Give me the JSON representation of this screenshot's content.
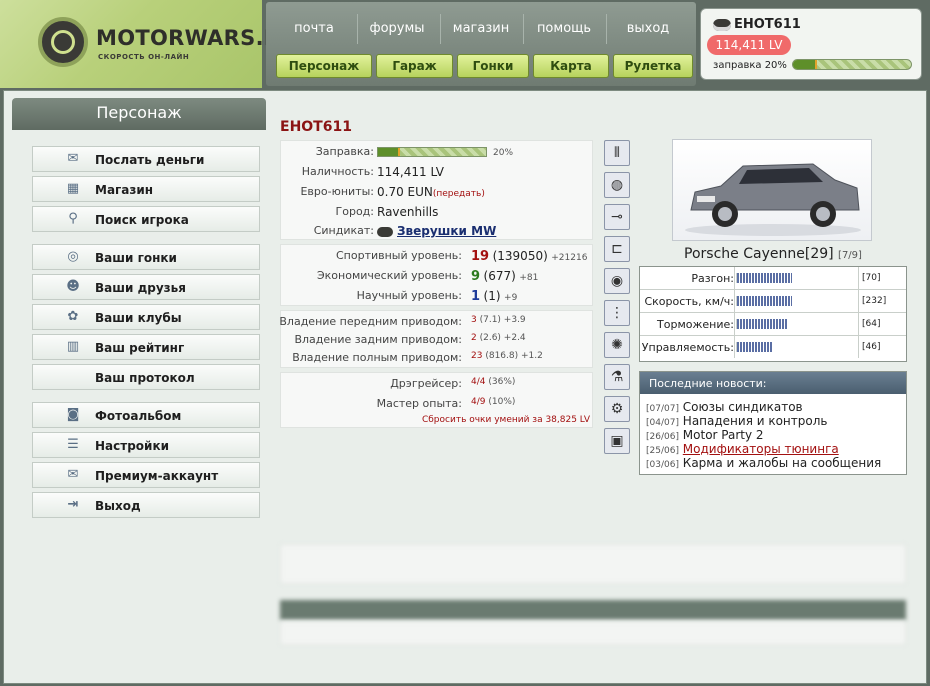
{
  "logo": {
    "title": "MOTORWARS.RU",
    "subtitle": "СКОРОСТЬ ОН-ЛАЙН"
  },
  "topnav": {
    "links": [
      "почта",
      "форумы",
      "магазин",
      "помощь",
      "выход"
    ],
    "buttons": [
      "Персонаж",
      "Гараж",
      "Гонки",
      "Карта",
      "Рулетка"
    ]
  },
  "user": {
    "name": "ЕНОТ611",
    "money": "114,411 LV",
    "fuel_label": "заправка 20%",
    "fuel_fraction": 0.2,
    "avatar_icon": "raccoon-icon"
  },
  "sidebar": {
    "title": "Персонаж",
    "items": [
      {
        "label": "Послать деньги",
        "icon": "money-icon"
      },
      {
        "label": "Магазин",
        "icon": "shop-icon"
      },
      {
        "label": "Поиск игрока",
        "icon": "search-icon"
      },
      {
        "label": "Ваши гонки",
        "icon": "steering-wheel-icon"
      },
      {
        "label": "Ваши друзья",
        "icon": "friends-icon"
      },
      {
        "label": "Ваши клубы",
        "icon": "clubs-icon"
      },
      {
        "label": "Ваш рейтинг",
        "icon": "rating-icon"
      },
      {
        "label": "Ваш протокол",
        "icon": ""
      },
      {
        "label": "Фотоальбом",
        "icon": "camera-icon"
      },
      {
        "label": "Настройки",
        "icon": "settings-icon"
      },
      {
        "label": "Премиум-аккаунт",
        "icon": "premium-icon"
      },
      {
        "label": "Выход",
        "icon": "exit-icon"
      }
    ]
  },
  "profile": {
    "name": "ЕНОТ611",
    "fuel": {
      "label": "Заправка:",
      "percent": "20%",
      "fraction": 0.2
    },
    "cash": {
      "label": "Наличность:",
      "value": "114,411 LV"
    },
    "euro": {
      "label": "Евро-юниты:",
      "value": "0.70 EUN",
      "link": "(передать)"
    },
    "city": {
      "label": "Город:",
      "value": "Ravenhills"
    },
    "syndicate": {
      "label": "Синдикат:",
      "value": "Зверушки MW"
    }
  },
  "levels": [
    {
      "label": "Спортивный уровень:",
      "level": "19",
      "points": "(139050)",
      "delta": "+21216"
    },
    {
      "label": "Экономический уровень:",
      "level": "9",
      "points": "(677)",
      "delta": "+81"
    },
    {
      "label": "Научный уровень:",
      "level": "1",
      "points": "(1)",
      "delta": "+9"
    }
  ],
  "drives": [
    {
      "label": "Владение передним приводом:",
      "value": "3",
      "detail": "(7.1) +3.9"
    },
    {
      "label": "Владение задним приводом:",
      "value": "2",
      "detail": "(2.6) +2.4"
    },
    {
      "label": "Владение полным приводом:",
      "value": "23",
      "detail": "(816.8) +1.2"
    }
  ],
  "skills": [
    {
      "label": "Дрэгрейсер:",
      "value": "4/4",
      "detail": "(36%)"
    },
    {
      "label": "Мастер опыта:",
      "value": "4/9",
      "detail": "(10%)"
    }
  ],
  "reset_link": "Сбросить очки умений за 38,825 LV",
  "tuning_icons": [
    "shock-absorber-icon",
    "tire-icon",
    "exhaust-icon",
    "intake-icon",
    "brake-disc-icon",
    "suspension-icon",
    "turbo-icon",
    "nitro-icon",
    "valve-icon",
    "ecu-icon"
  ],
  "car": {
    "name": "Porsche Cayenne[29]",
    "slot": "[7/9]",
    "stats": [
      {
        "label": "Разгон:",
        "value": "[70]",
        "fraction": 0.7
      },
      {
        "label": "Скорость, км/ч:",
        "value": "[232]",
        "fraction": 0.7
      },
      {
        "label": "Торможение:",
        "value": "[64]",
        "fraction": 0.64
      },
      {
        "label": "Управляемость:",
        "value": "[46]",
        "fraction": 0.46
      }
    ]
  },
  "news": {
    "title": "Последние новости:",
    "items": [
      {
        "date": "[07/07]",
        "text": "Союзы синдикатов"
      },
      {
        "date": "[04/07]",
        "text": "Нападения и контроль"
      },
      {
        "date": "[26/06]",
        "text": "Motor Party 2"
      },
      {
        "date": "[25/06]",
        "text": "Модификаторы тюнинга"
      },
      {
        "date": "[03/06]",
        "text": "Карма и жалобы на сообщения"
      }
    ]
  },
  "colors": {
    "accent_green": "#b6d25c",
    "header_gray": "#6f7b72",
    "level_red": "#a31010",
    "money_badge": "#f06a6a"
  }
}
